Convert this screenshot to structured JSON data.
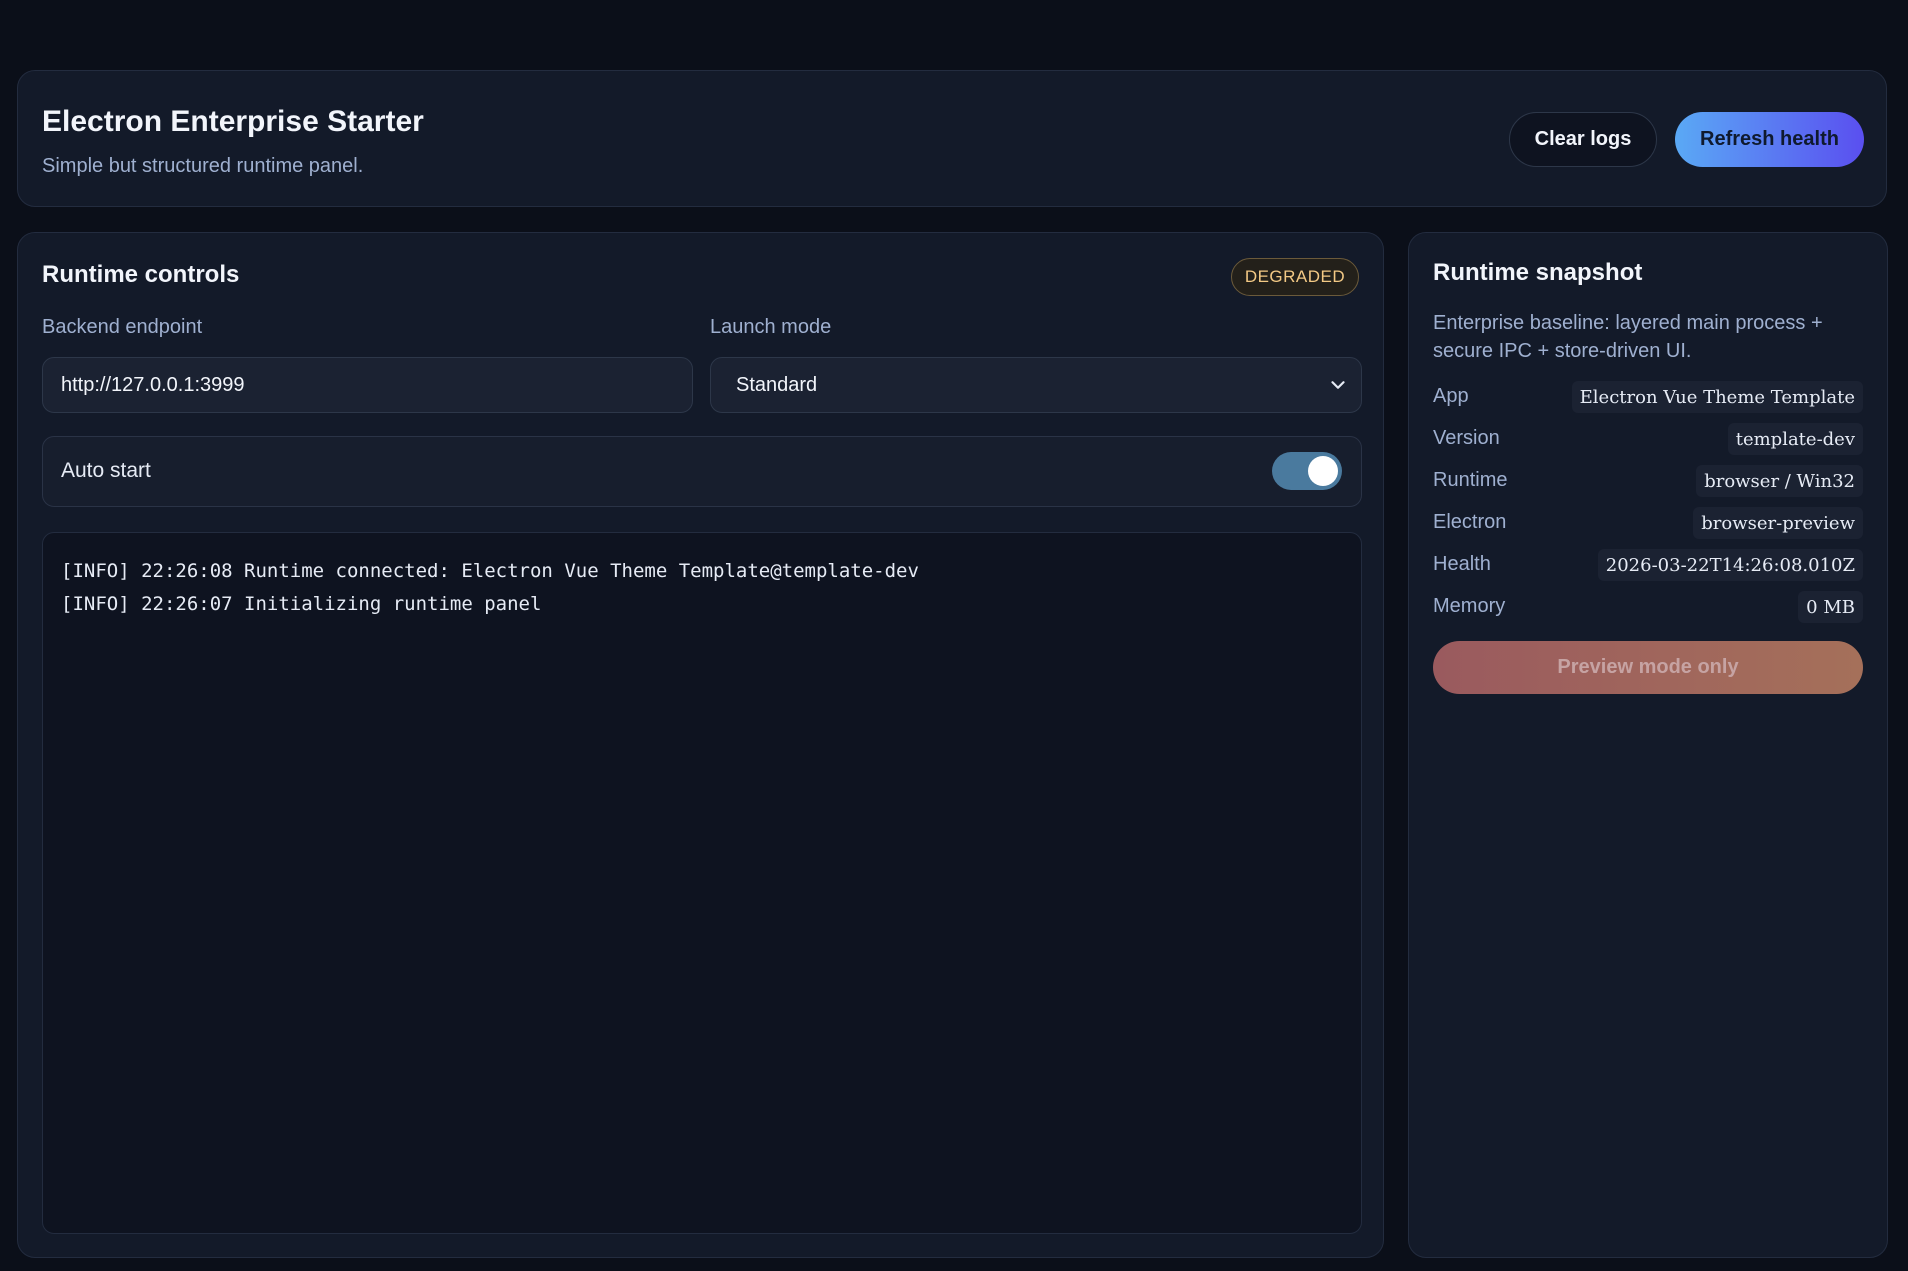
{
  "header": {
    "title": "Electron Enterprise Starter",
    "subtitle": "Simple but structured runtime panel.",
    "clear_logs_label": "Clear logs",
    "refresh_health_label": "Refresh health"
  },
  "controls": {
    "title": "Runtime controls",
    "status_badge": "DEGRADED",
    "backend_label": "Backend endpoint",
    "backend_value": "http://127.0.0.1:3999",
    "launch_label": "Launch mode",
    "launch_value": "Standard",
    "auto_start_label": "Auto start",
    "auto_start_on": true,
    "logs": [
      "[INFO] 22:26:08 Runtime connected: Electron Vue Theme Template@template-dev",
      "[INFO] 22:26:07 Initializing runtime panel"
    ]
  },
  "snapshot": {
    "title": "Runtime snapshot",
    "description": "Enterprise baseline: layered main process + secure IPC + store-driven UI.",
    "rows": [
      {
        "key": "App",
        "value": "Electron Vue Theme Template"
      },
      {
        "key": "Version",
        "value": "template-dev"
      },
      {
        "key": "Runtime",
        "value": "browser / Win32"
      },
      {
        "key": "Electron",
        "value": "browser-preview"
      },
      {
        "key": "Health",
        "value": "2026-03-22T14:26:08.010Z"
      },
      {
        "key": "Memory",
        "value": "0 MB"
      }
    ],
    "preview_label": "Preview mode only"
  },
  "colors": {
    "background": "#0b0f19",
    "panel": "#131a29",
    "accent_start": "#5aa9f5",
    "accent_end": "#5a4ff0",
    "badge_text": "#f3c985"
  }
}
